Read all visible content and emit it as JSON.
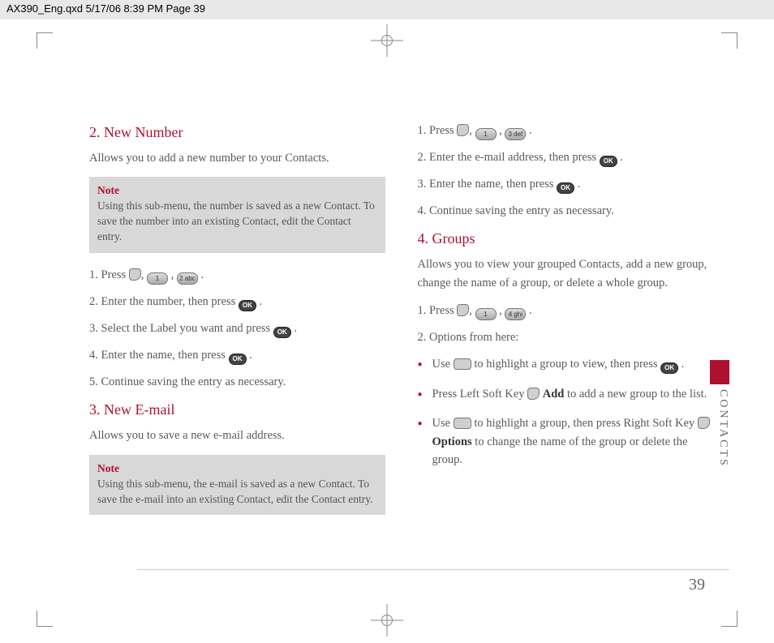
{
  "header": "AX390_Eng.qxd  5/17/06  8:39 PM  Page 39",
  "left": {
    "h2": "2. New Number",
    "h2sub": "Allows you to add a new number to your Contacts.",
    "note1title": "Note",
    "note1body": "Using this sub-menu, the number is saved as a new Contact. To save the number into an existing Contact, edit the Contact entry.",
    "s1a": "1. Press ",
    "s1b": ",  ",
    "s1c": " ,  ",
    "s1d": " .",
    "key1label": "1",
    "key2label": "2 abc",
    "s2a": "2. Enter the number, then press ",
    "s2d": " .",
    "s3a": "3. Select the Label you want and press ",
    "s3d": " .",
    "s4a": "4. Enter the name, then press ",
    "s4d": " .",
    "s5": "5. Continue saving the entry as necessary.",
    "h3": "3. New E-mail",
    "h3sub": "Allows you to save a new e-mail address.",
    "note2title": "Note",
    "note2body": "Using this sub-menu, the e-mail is saved as a new Contact. To save the e-mail into an existing Contact, edit the Contact entry."
  },
  "right": {
    "r1a": "1. Press ",
    "key3label": "3 def",
    "r2a": "2. Enter the e-mail address, then press ",
    "r3a": "3. Enter the name, then press ",
    "r4": "4. Continue saving the entry as necessary.",
    "h4": "4. Groups",
    "h4sub": "Allows you to view your grouped Contacts, add a new group, change the name of a group, or delete a whole group.",
    "g1a": "1. Press ",
    "key4label": "4 ghi",
    "g2": "2. Options from here:",
    "b1a": "Use ",
    "b1b": " to highlight a group to view, then press ",
    "b1c": " .",
    "b2a": "Press Left Soft Key ",
    "b2bold": "Add",
    "b2b": " to add a new group to the list.",
    "b3a": "Use ",
    "b3b": " to highlight a group, then press Right Soft Key ",
    "b3bold": "Options",
    "b3c": " to change the name of the group or delete the group."
  },
  "sidetab": "CONTACTS",
  "pagenum": "39",
  "ok": "OK"
}
